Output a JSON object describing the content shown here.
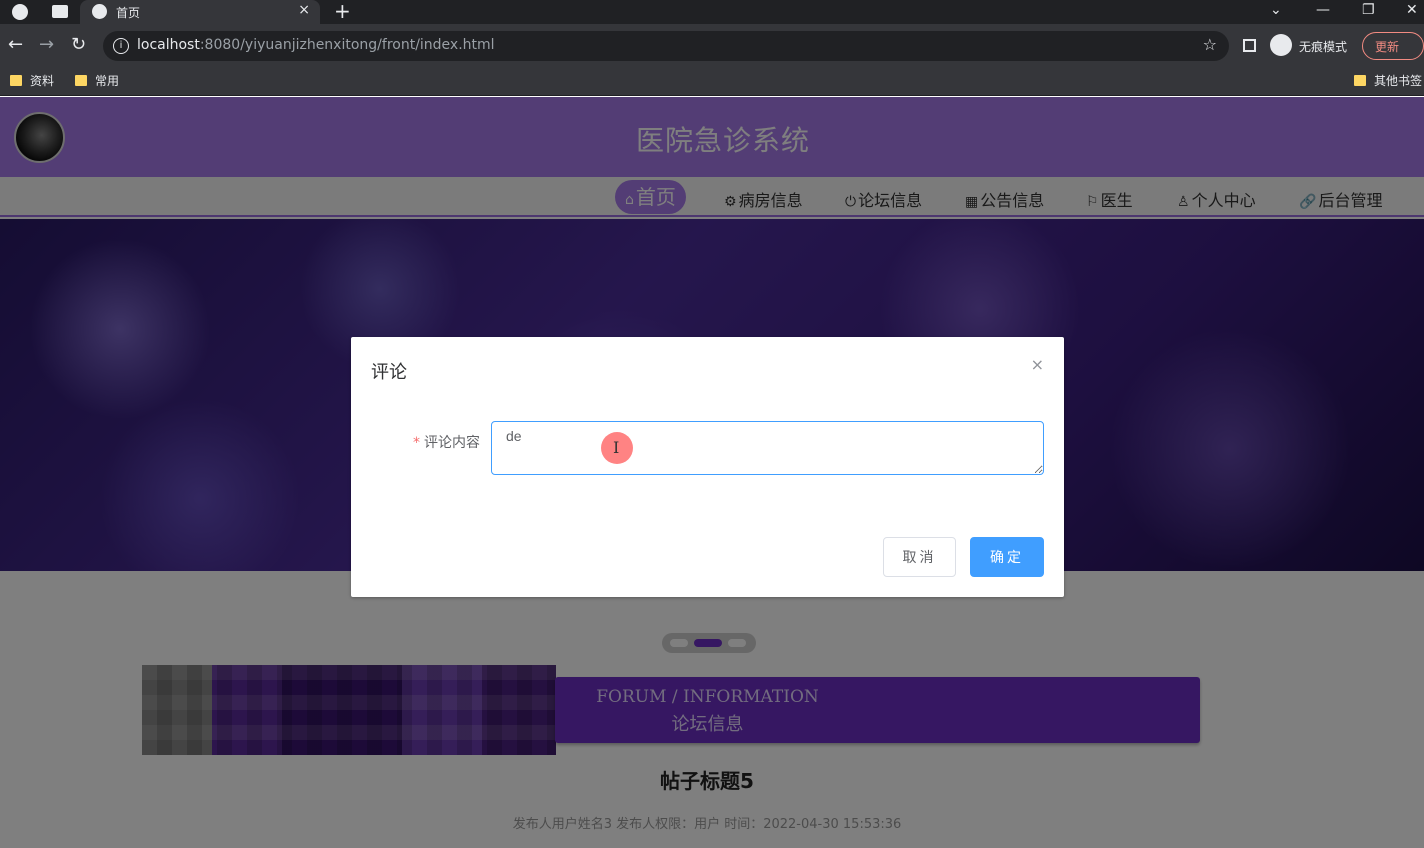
{
  "browser": {
    "tab_title": "首页",
    "tab_close": "×",
    "new_tab": "+",
    "url_host": "localhost",
    "url_rest": ":8080/yiyuanjizhenxitong/front/index.html",
    "incognito_label": "无痕模式",
    "update_label": "更新",
    "bookmarks": [
      "资料",
      "常用"
    ],
    "other_bookmarks": "其他书签",
    "window_controls": [
      "⌄",
      "—",
      "❐",
      "✕"
    ]
  },
  "site": {
    "title": "医院急诊系统",
    "nav": [
      {
        "icon": "⌂",
        "label": "首页"
      },
      {
        "icon": "⚙",
        "label": "病房信息"
      },
      {
        "icon": "⏻",
        "label": "论坛信息"
      },
      {
        "icon": "▦",
        "label": "公告信息"
      },
      {
        "icon": "⚐",
        "label": "医生"
      },
      {
        "icon": "♙",
        "label": "个人中心"
      },
      {
        "icon": "🔗",
        "label": "后台管理"
      }
    ]
  },
  "section": {
    "title_en": "FORUM / INFORMATION",
    "title_cn": "论坛信息"
  },
  "post": {
    "title": "帖子标题5",
    "meta": "发布人用户姓名3   发布人权限：用户   时间：2022-04-30 15:53:36"
  },
  "dialog": {
    "title": "评论",
    "close": "×",
    "field_label": "评论内容",
    "field_required": "*",
    "field_value": "de",
    "cancel_label": "取消",
    "confirm_label": "确定"
  },
  "colors": {
    "header": "#a77bea",
    "section_bar": "#6d2fc4",
    "primary_button": "#409eff"
  }
}
